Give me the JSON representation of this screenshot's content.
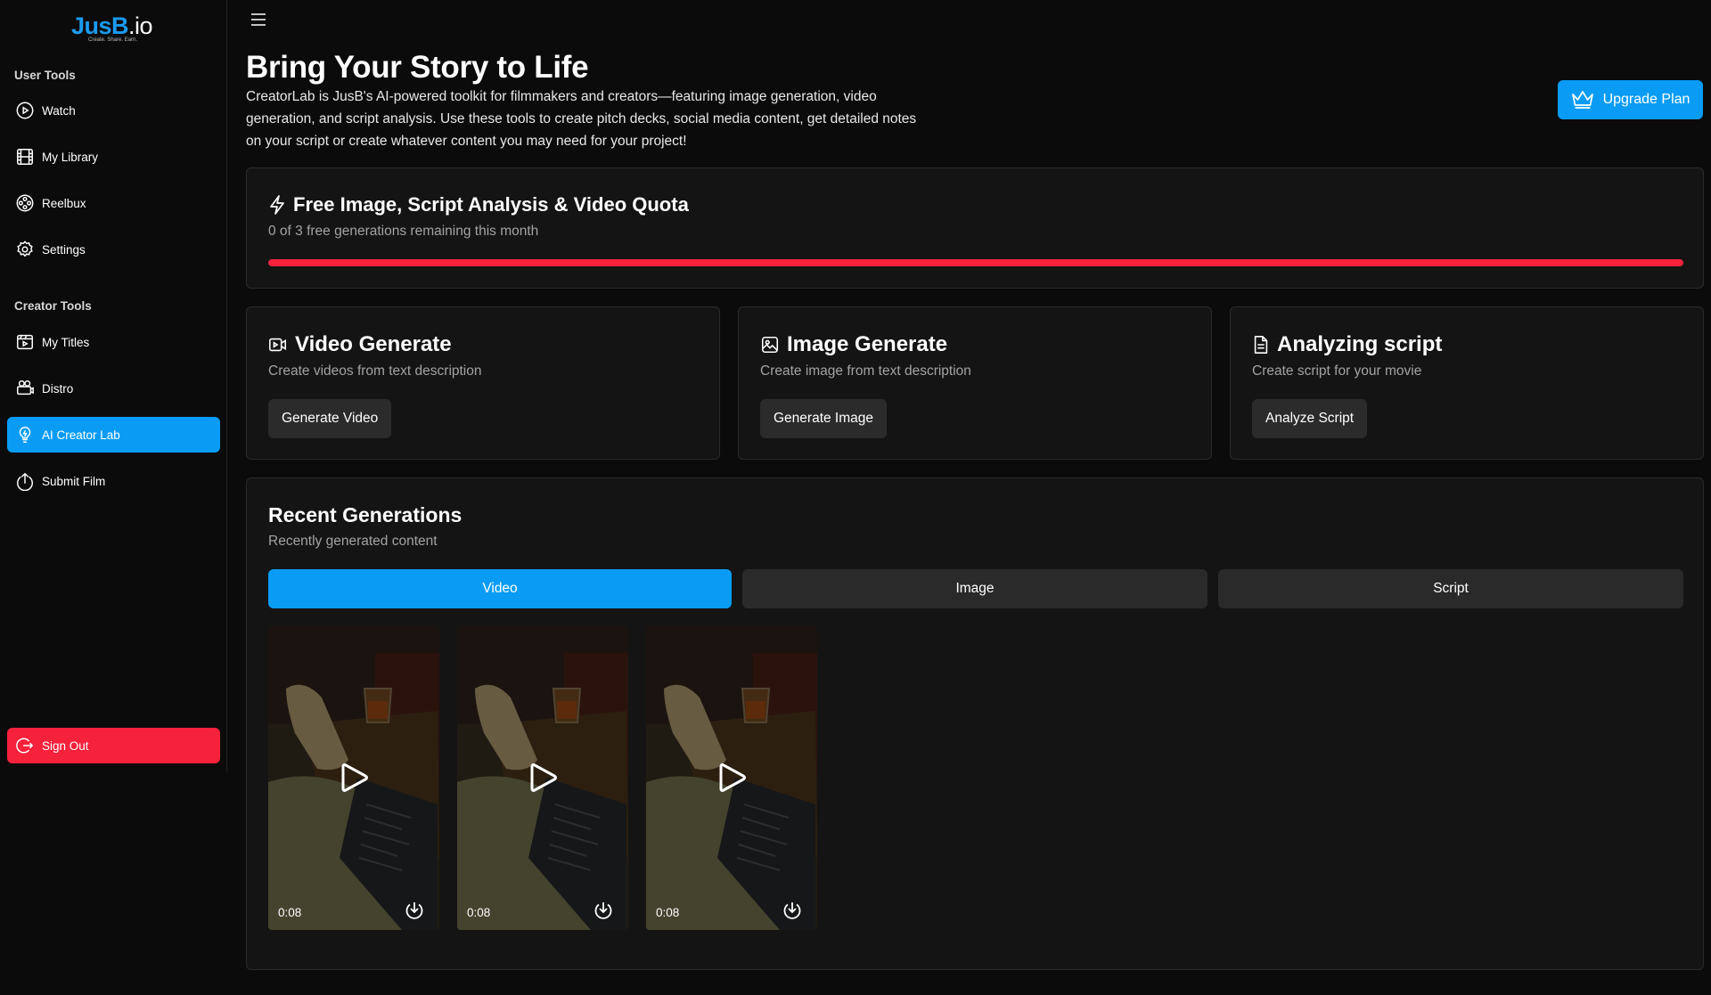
{
  "brand": {
    "name": "JusB",
    "suffix": ".io",
    "tagline": "Create. Share. Earn."
  },
  "sidebar": {
    "user_tools_title": "User Tools",
    "user_items": [
      {
        "label": "Watch",
        "icon": "play-circle-icon"
      },
      {
        "label": "My Library",
        "icon": "film-icon"
      },
      {
        "label": "Reelbux",
        "icon": "film-reel-icon"
      },
      {
        "label": "Settings",
        "icon": "gear-icon"
      }
    ],
    "creator_tools_title": "Creator Tools",
    "creator_items": [
      {
        "label": "My Titles",
        "icon": "video-icon"
      },
      {
        "label": "Distro",
        "icon": "projector-icon"
      },
      {
        "label": "AI Creator Lab",
        "icon": "lightbulb-icon",
        "active": true
      },
      {
        "label": "Submit Film",
        "icon": "upload-icon"
      }
    ],
    "sign_out": "Sign Out"
  },
  "header": {
    "title": "Bring Your Story to Life",
    "description": "CreatorLab is JusB's AI-powered toolkit for filmmakers and creators—featuring image generation, video generation, and script analysis. Use these tools to create pitch decks, social media content, get detailed notes on your script or create whatever content you may need for your project!",
    "upgrade_label": "Upgrade Plan"
  },
  "quota": {
    "title": "Free Image, Script Analysis & Video Quota",
    "subtitle": "0 of 3 free generations remaining this month",
    "used_fraction": 1.0
  },
  "tools": [
    {
      "title": "Video Generate",
      "subtitle": "Create videos from text description",
      "button": "Generate Video",
      "icon": "video-camera-icon"
    },
    {
      "title": "Image Generate",
      "subtitle": "Create image from text description",
      "button": "Generate Image",
      "icon": "image-icon"
    },
    {
      "title": "Analyzing script",
      "subtitle": "Create script for your movie",
      "button": "Analyze Script",
      "icon": "document-icon"
    }
  ],
  "recent": {
    "title": "Recent Generations",
    "subtitle": "Recently generated content",
    "tabs": [
      "Video",
      "Image",
      "Script"
    ],
    "active_tab": "Video",
    "videos": [
      {
        "duration": "0:08"
      },
      {
        "duration": "0:08"
      },
      {
        "duration": "0:08"
      }
    ]
  },
  "colors": {
    "accent": "#0a9cf5",
    "danger": "#f6213b",
    "background": "#0b0b0b",
    "card": "#141414"
  }
}
